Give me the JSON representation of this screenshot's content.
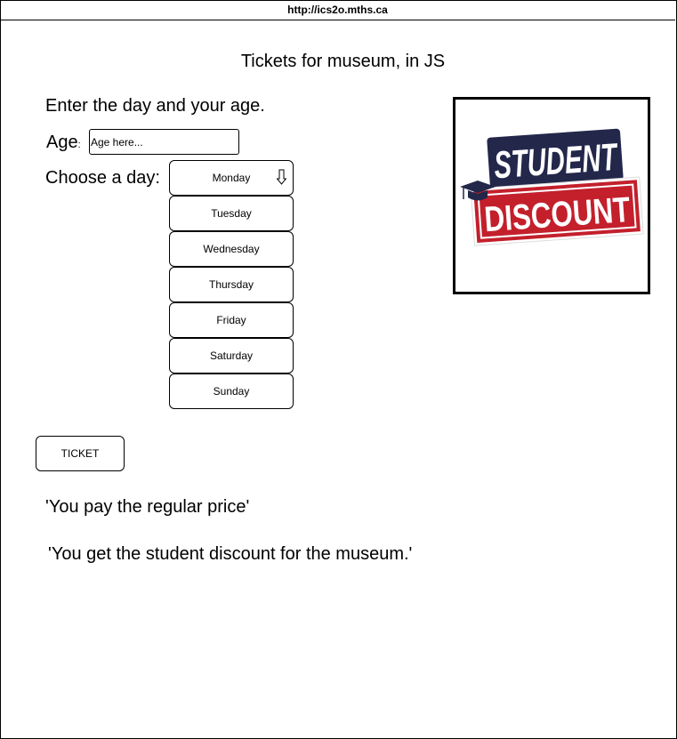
{
  "browser": {
    "url": "http://ics2o.mths.ca"
  },
  "page": {
    "title": "Tickets for museum, in JS",
    "prompt": "Enter the day and your age.",
    "age_label": "Age",
    "age_colon": ":",
    "age_placeholder": "Age here...",
    "day_label": "Choose a day:"
  },
  "days": [
    "Monday",
    "Tuesday",
    "Wednesday",
    "Thursday",
    "Friday",
    "Saturday",
    "Sunday"
  ],
  "selected_day": "Monday",
  "ticket_button": "TICKET",
  "messages": {
    "regular": "'You pay the regular price'",
    "discount": "'You get the student discount for the museum.'"
  },
  "logo": {
    "line1": "STUDENT",
    "line2": "DISCOUNT",
    "navy": "#23274a",
    "red": "#c3202c"
  },
  "icons": {
    "dropdown": "down-arrow-icon",
    "cap": "graduation-cap-icon"
  }
}
